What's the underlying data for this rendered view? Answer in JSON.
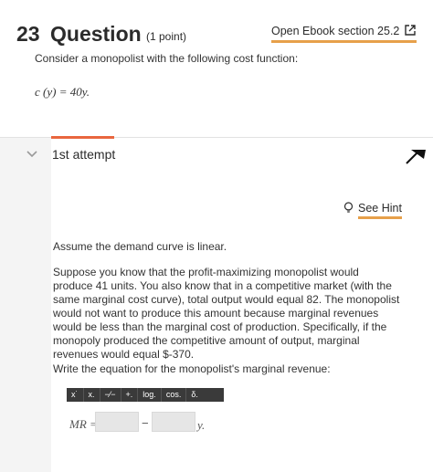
{
  "question": {
    "number": "23",
    "word": "Question",
    "points": "(1 point)",
    "ebook_link": "Open Ebook section 25.2",
    "prompt": "Consider a monopolist with the following cost function:",
    "cost_function": "c (y) = 40y."
  },
  "attempt": {
    "title": "1st attempt",
    "hint_label": "See Hint",
    "paragraph1": "Assume the demand curve is linear.",
    "paragraph2": "Suppose you know that the profit-maximizing monopolist would produce 41 units. You also know that in a competitive market (with the same marginal cost curve), total output would equal 82. The monopolist would not want to produce this amount because marginal revenues would be less than the marginal cost of production. Specifically, if the monopoly produced the competitive amount of output, marginal revenues would equal $-370.",
    "paragraph3": "Write the equation for the monopolist's marginal revenue:",
    "toolbar": [
      "x˙",
      "x.",
      "−⁄−",
      "+.",
      "log.",
      "cos.",
      "δ."
    ],
    "mr_label": "MR =",
    "minus": "−",
    "y_suffix": "y.",
    "answer1": "",
    "answer2": ""
  },
  "colors": {
    "accent_underline": "#e7a04a",
    "tab_indicator": "#e9663e",
    "toolbar_bg": "#3a3a3a",
    "input_bg": "#e6e6e6"
  }
}
